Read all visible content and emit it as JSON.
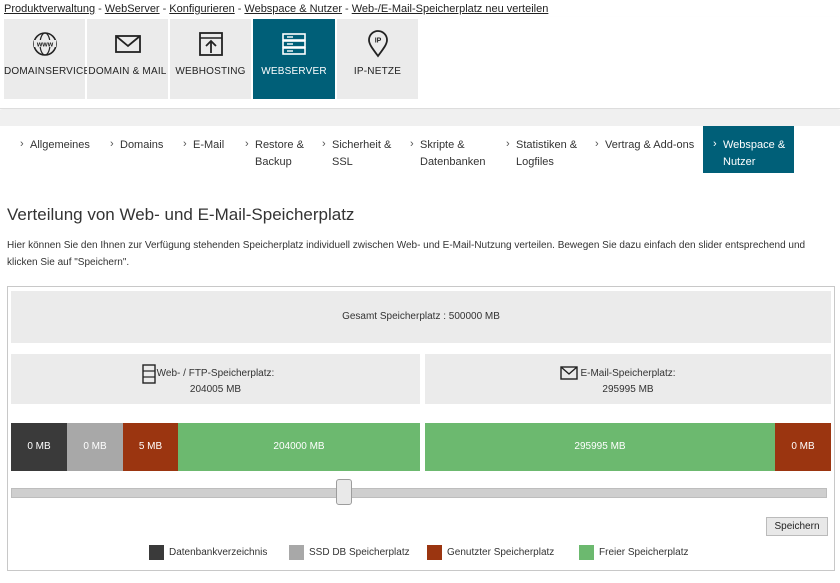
{
  "breadcrumb": [
    "Produktverwaltung",
    "WebServer",
    "Konfigurieren",
    "Webspace & Nutzer",
    "Web-/E-Mail-Speicherplatz neu verteilen"
  ],
  "topnav": [
    {
      "label": "DOMAINSERVICES",
      "icon": "www-globe-icon"
    },
    {
      "label": "DOMAIN & MAIL",
      "icon": "envelope-icon"
    },
    {
      "label": "WEBHOSTING",
      "icon": "upload-browser-icon"
    },
    {
      "label": "WEBSERVER",
      "icon": "server-icon",
      "active": true
    },
    {
      "label": "IP-NETZE",
      "icon": "ip-pin-icon"
    }
  ],
  "tabs": [
    {
      "label": "Allgemeines"
    },
    {
      "label": "Domains"
    },
    {
      "label": "E-Mail"
    },
    {
      "label": "Restore &\nBackup"
    },
    {
      "label": "Sicherheit &\nSSL"
    },
    {
      "label": "Skripte &\nDatenbanken"
    },
    {
      "label": "Statistiken &\nLogfiles"
    },
    {
      "label": "Vertrag & Add-ons"
    },
    {
      "label": "Webspace &\nNutzer",
      "active": true
    }
  ],
  "page": {
    "title": "Verteilung von Web- und E-Mail-Speicherplatz",
    "intro": "Hier können Sie den Ihnen zur Verfügung stehenden Speicherplatz individuell zwischen Web- und E-Mail-Nutzung verteilen. Bewegen Sie dazu einfach den slider entsprechend und klicken Sie auf \"Speichern\"."
  },
  "storage": {
    "total_label": "Gesamt Speicherplatz : 500000 MB",
    "web_label": "Web- / FTP-Speicherplatz:",
    "web_value": "204005 MB",
    "mail_label": "E-Mail-Speicherplatz:",
    "mail_value": "295995 MB",
    "bars": {
      "db": "0 MB",
      "ssd": "0 MB",
      "used_web": "5 MB",
      "free_web": "204000 MB",
      "free_mail": "295995 MB",
      "used_mail": "0 MB"
    },
    "slider_fraction": 0.408,
    "save_label": "Speichern"
  },
  "legend": [
    {
      "label": "Datenbankverzeichnis",
      "color": "#3a3a3a"
    },
    {
      "label": "SSD DB Speicherplatz",
      "color": "#a8a8a8"
    },
    {
      "label": "Genutzter Speicherplatz",
      "color": "#9b3510"
    },
    {
      "label": "Freier Speicherplatz",
      "color": "#6cb96f"
    }
  ],
  "colors": {
    "accent": "#005f78",
    "tile_bg": "#ebebeb"
  }
}
